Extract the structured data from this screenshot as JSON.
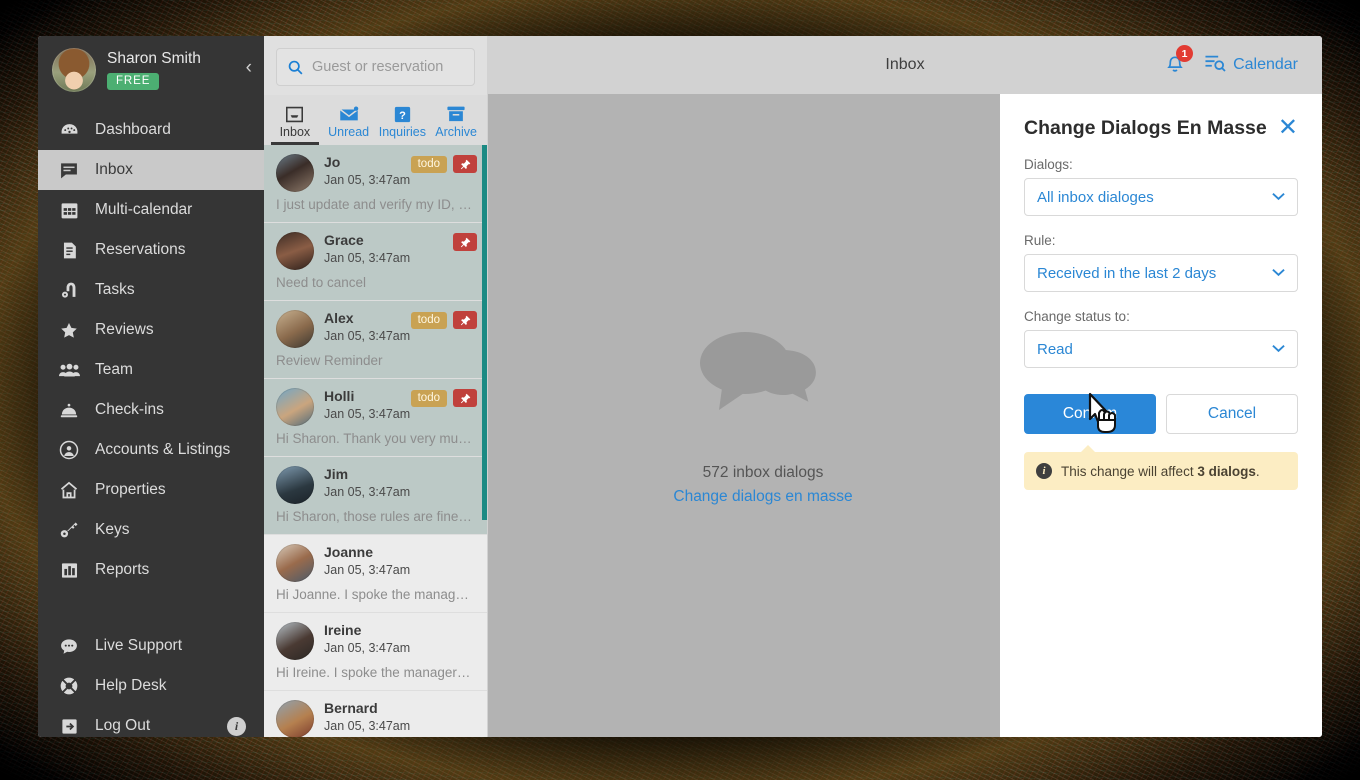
{
  "sidebar": {
    "profile": {
      "name": "Sharon Smith",
      "plan_badge": "FREE"
    },
    "collapse_glyph": "‹",
    "items": [
      {
        "label": "Dashboard",
        "icon": "speedometer-icon",
        "active": false
      },
      {
        "label": "Inbox",
        "icon": "chat-box-icon",
        "active": true
      },
      {
        "label": "Multi-calendar",
        "icon": "calendar-grid-icon",
        "active": false
      },
      {
        "label": "Reservations",
        "icon": "reservations-icon",
        "active": false
      },
      {
        "label": "Tasks",
        "icon": "vacuum-icon",
        "active": false
      },
      {
        "label": "Reviews",
        "icon": "star-icon",
        "active": false
      },
      {
        "label": "Team",
        "icon": "people-icon",
        "active": false
      },
      {
        "label": "Check-ins",
        "icon": "bell-desk-icon",
        "active": false
      },
      {
        "label": "Accounts & Listings",
        "icon": "account-circle-icon",
        "active": false
      },
      {
        "label": "Properties",
        "icon": "house-icon",
        "active": false
      },
      {
        "label": "Keys",
        "icon": "key-icon",
        "active": false
      },
      {
        "label": "Reports",
        "icon": "bar-chart-icon",
        "active": false
      }
    ],
    "bottom_items": [
      {
        "label": "Live Support",
        "icon": "speech-bubble-dots-icon"
      },
      {
        "label": "Help Desk",
        "icon": "lifebuoy-icon"
      },
      {
        "label": "Log Out",
        "icon": "logout-arrow-icon",
        "info": "i"
      }
    ]
  },
  "list_panel": {
    "search": {
      "placeholder": "Guest or reservation",
      "value": "",
      "icon": "search-icon"
    },
    "tabs": [
      {
        "label": "Inbox",
        "icon": "inbox-tray-icon",
        "active": true
      },
      {
        "label": "Unread",
        "icon": "unread-envelope-icon",
        "active": false
      },
      {
        "label": "Inquiries",
        "icon": "question-square-icon",
        "active": false
      },
      {
        "label": "Archive",
        "icon": "archive-box-icon",
        "active": false
      }
    ],
    "messages": [
      {
        "name": "Jo",
        "date": "Jan 05, 3:47am",
        "preview": "I just update and verify my ID, p…",
        "todo": "todo",
        "pinned": true,
        "selected": true
      },
      {
        "name": "Grace",
        "date": "Jan 05, 3:47am",
        "preview": "Need to cancel",
        "todo": "",
        "pinned": true,
        "selected": true
      },
      {
        "name": "Alex",
        "date": "Jan 05, 3:47am",
        "preview": "Review Reminder",
        "todo": "todo",
        "pinned": true,
        "selected": true
      },
      {
        "name": "Holli",
        "date": "Jan 05, 3:47am",
        "preview": "Hi Sharon. Thank you very much…",
        "todo": "todo",
        "pinned": true,
        "selected": true
      },
      {
        "name": "Jim",
        "date": "Jan 05, 3:47am",
        "preview": "Hi Sharon, those rules are fine b…",
        "todo": "",
        "pinned": false,
        "selected": true
      },
      {
        "name": "Joanne",
        "date": "Jan 05, 3:47am",
        "preview": "Hi Joanne. I spoke the manager…",
        "todo": "",
        "pinned": false,
        "selected": false
      },
      {
        "name": "Ireine",
        "date": "Jan 05, 3:47am",
        "preview": "Hi Ireine. I spoke the manager…",
        "todo": "",
        "pinned": false,
        "selected": false
      },
      {
        "name": "Bernard",
        "date": "Jan 05, 3:47am",
        "preview": "Hi Bernard. I spoke the manage…",
        "todo": "",
        "pinned": false,
        "selected": false
      }
    ]
  },
  "topbar": {
    "title": "Inbox",
    "notification_count": "1",
    "notification_icon": "bell-icon",
    "calendar_label": "Calendar",
    "calendar_icon": "calendar-search-icon"
  },
  "empty_state": {
    "icon": "two-speech-bubbles-icon",
    "count_text": "572 inbox dialogs",
    "link_text": "Change dialogs en masse"
  },
  "right_panel": {
    "title": "Change Dialogs En Masse",
    "close_icon": "close-icon",
    "close_glyph": "✕",
    "fields": [
      {
        "label": "Dialogs:",
        "value": "All inbox dialoges"
      },
      {
        "label": "Rule:",
        "value": "Received in the last 2 days"
      },
      {
        "label": "Change status to:",
        "value": "Read"
      }
    ],
    "confirm_label": "Confirm",
    "cancel_label": "Cancel",
    "note_prefix": "This change will affect ",
    "note_strong": "3 dialogs",
    "note_suffix": ".",
    "note_icon": "info-icon"
  },
  "colors": {
    "accent_blue": "#2b87d4",
    "primary_button": "#2a87d8",
    "sidebar_bg": "#353535",
    "selected_row": "#bcc9c6",
    "scrollbar_teal": "#1b8a83",
    "todo_tag": "#c9a253",
    "pin_tag": "#c0413c",
    "free_badge": "#4caf72",
    "note_bg": "#fcedc3",
    "notification_red": "#e23b32"
  }
}
